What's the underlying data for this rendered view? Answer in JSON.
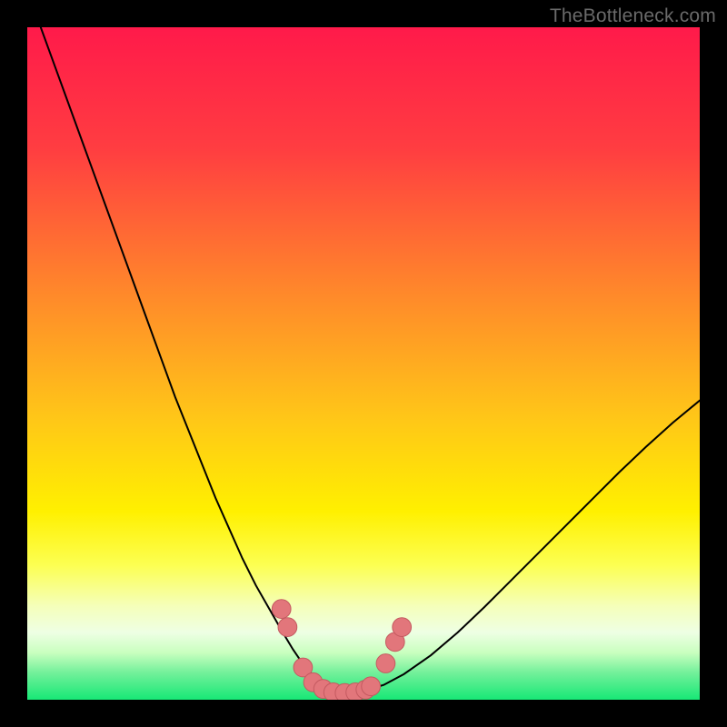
{
  "watermark": "TheBottleneck.com",
  "colors": {
    "black": "#000000",
    "curve": "#000000",
    "dot_fill": "#e2767b",
    "dot_stroke": "#c45a60"
  },
  "chart_data": {
    "type": "line",
    "title": "",
    "xlabel": "",
    "ylabel": "",
    "xlim": [
      0,
      100
    ],
    "ylim": [
      0,
      100
    ],
    "gradient_stops": [
      {
        "offset": 0,
        "color": "#ff1a4a"
      },
      {
        "offset": 18,
        "color": "#ff3d41"
      },
      {
        "offset": 40,
        "color": "#ff8a2a"
      },
      {
        "offset": 58,
        "color": "#ffc618"
      },
      {
        "offset": 72,
        "color": "#fff000"
      },
      {
        "offset": 80,
        "color": "#fcff52"
      },
      {
        "offset": 86,
        "color": "#f5ffb9"
      },
      {
        "offset": 90,
        "color": "#eeffe4"
      },
      {
        "offset": 93,
        "color": "#c9ffbf"
      },
      {
        "offset": 96,
        "color": "#72f09a"
      },
      {
        "offset": 100,
        "color": "#17e876"
      }
    ],
    "series": [
      {
        "name": "bottleneck-curve",
        "x": [
          2,
          4,
          6,
          8,
          10,
          12,
          14,
          16,
          18,
          20,
          22,
          24,
          26,
          28,
          30,
          32,
          34,
          36,
          38,
          39.5,
          41,
          42.5,
          44,
          45,
          46,
          48,
          50,
          53,
          56,
          60,
          64,
          68,
          72,
          76,
          80,
          84,
          88,
          92,
          96,
          100
        ],
        "y": [
          100,
          94.5,
          89,
          83.5,
          78,
          72.5,
          67,
          61.5,
          56,
          50.5,
          45,
          40,
          35,
          30,
          25.5,
          21,
          17,
          13.5,
          10,
          7.5,
          5.3,
          3.6,
          2.3,
          1.6,
          1.2,
          1.0,
          1.3,
          2.2,
          3.8,
          6.6,
          10.0,
          13.8,
          17.8,
          21.8,
          25.8,
          29.8,
          33.8,
          37.6,
          41.2,
          44.5
        ]
      }
    ],
    "marker_points": [
      {
        "x": 37.8,
        "y": 13.5,
        "r": 1.4
      },
      {
        "x": 38.7,
        "y": 10.8,
        "r": 1.4
      },
      {
        "x": 41.0,
        "y": 4.8,
        "r": 1.4
      },
      {
        "x": 42.5,
        "y": 2.6,
        "r": 1.4
      },
      {
        "x": 44.0,
        "y": 1.6,
        "r": 1.4
      },
      {
        "x": 45.5,
        "y": 1.1,
        "r": 1.4
      },
      {
        "x": 47.2,
        "y": 1.0,
        "r": 1.4
      },
      {
        "x": 48.8,
        "y": 1.1,
        "r": 1.4
      },
      {
        "x": 50.3,
        "y": 1.5,
        "r": 1.4
      },
      {
        "x": 51.1,
        "y": 2.0,
        "r": 1.4
      },
      {
        "x": 53.3,
        "y": 5.4,
        "r": 1.4
      },
      {
        "x": 54.7,
        "y": 8.6,
        "r": 1.4
      },
      {
        "x": 55.7,
        "y": 10.8,
        "r": 1.4
      }
    ]
  }
}
